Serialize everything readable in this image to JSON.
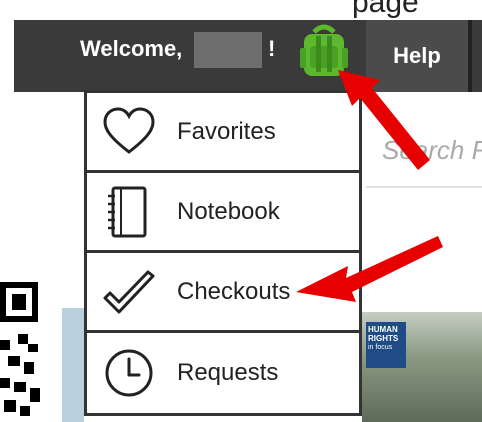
{
  "page": {
    "top_text": "page",
    "header": {
      "welcome": "Welcome,",
      "exclaim": "!",
      "help_tab": "Help"
    },
    "search": {
      "placeholder": "Search R"
    },
    "badge": {
      "line1": "HUMAN",
      "line2": "RIGHTS",
      "line3": "in focus"
    }
  },
  "menu": {
    "items": [
      {
        "label": "Favorites",
        "icon": "heart-icon"
      },
      {
        "label": "Notebook",
        "icon": "notebook-icon"
      },
      {
        "label": "Checkouts",
        "icon": "checkmark-icon"
      },
      {
        "label": "Requests",
        "icon": "clock-icon"
      }
    ]
  },
  "colors": {
    "header_bg": "#3a3a3a",
    "help_bg": "#4b4b4b",
    "backpack_green": "#5cb82e",
    "arrow_red": "#e60000"
  }
}
